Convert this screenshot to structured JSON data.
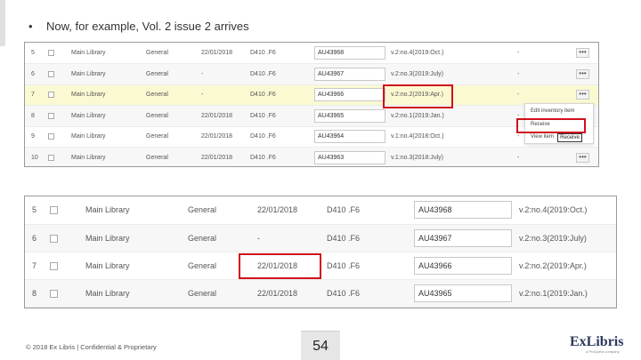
{
  "bullet": {
    "symbol": "•",
    "text": "Now, for example, Vol. 2 issue 2 arrives"
  },
  "table_small": {
    "rows": [
      {
        "num": "5",
        "library": "Main Library",
        "location": "General",
        "date": "22/01/2018",
        "call": "D410 .F6",
        "barcode": "AU43968",
        "desc": "v.2:no.4(2019:Oct.)",
        "extra": "-"
      },
      {
        "num": "6",
        "library": "Main Library",
        "location": "General",
        "date": "-",
        "call": "D410 .F6",
        "barcode": "AU43967",
        "desc": "v.2:no.3(2019:July)",
        "extra": "-"
      },
      {
        "num": "7",
        "library": "Main Library",
        "location": "General",
        "date": "-",
        "call": "D410 .F6",
        "barcode": "AU43966",
        "desc": "v.2:no.2(2019:Apr.)",
        "extra": "-"
      },
      {
        "num": "8",
        "library": "Main Library",
        "location": "General",
        "date": "22/01/2018",
        "call": "D410 .F6",
        "barcode": "AU43965",
        "desc": "v.2:no.1(2019:Jan.)",
        "extra": "-"
      },
      {
        "num": "9",
        "library": "Main Library",
        "location": "General",
        "date": "22/01/2018",
        "call": "D410 .F6",
        "barcode": "AU43964",
        "desc": "v.1:no.4(2018:Oct.)",
        "extra": "-"
      },
      {
        "num": "10",
        "library": "Main Library",
        "location": "General",
        "date": "22/01/2018",
        "call": "D410 .F6",
        "barcode": "AU43963",
        "desc": "v.1:no.3(2018:July)",
        "extra": "-"
      }
    ],
    "more_label": "•••"
  },
  "row_menu": {
    "item1": "Edit inventory item",
    "item2": "Receive",
    "item3": "View item",
    "tooltip": "Receive"
  },
  "table_large": {
    "rows": [
      {
        "num": "5",
        "library": "Main Library",
        "location": "General",
        "date": "22/01/2018",
        "call": "D410 .F6",
        "barcode": "AU43968",
        "desc": "v.2:no.4(2019:Oct.)"
      },
      {
        "num": "6",
        "library": "Main Library",
        "location": "General",
        "date": "-",
        "call": "D410 .F6",
        "barcode": "AU43967",
        "desc": "v.2:no.3(2019:July)"
      },
      {
        "num": "7",
        "library": "Main Library",
        "location": "General",
        "date": "22/01/2018",
        "call": "D410 .F6",
        "barcode": "AU43966",
        "desc": "v.2:no.2(2019:Apr.)"
      },
      {
        "num": "8",
        "library": "Main Library",
        "location": "General",
        "date": "22/01/2018",
        "call": "D410 .F6",
        "barcode": "AU43965",
        "desc": "v.2:no.1(2019:Jan.)"
      }
    ]
  },
  "footer": {
    "copyright": "© 2018 Ex Libris | Confidential & Proprietary",
    "page_number": "54",
    "logo_text": "ExLibris",
    "logo_tagline": "a ProQuest company"
  },
  "colors": {
    "highlight_row": "#fbf9d2",
    "annotation_red": "#d0101d",
    "logo": "#2d3a5c"
  },
  "icons": {
    "bullet": "bullet-dot",
    "more": "ellipsis-icon",
    "checkbox": "checkbox-icon"
  }
}
